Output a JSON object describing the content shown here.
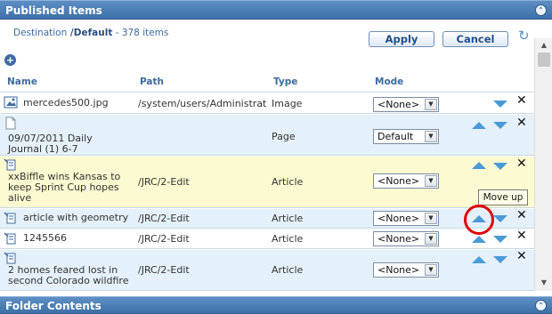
{
  "panel": {
    "title": "Published Items"
  },
  "breadcrumb": {
    "destination": "Destination",
    "sep": " /",
    "folder": "Default",
    "count_text": " - 378 items"
  },
  "toolbar": {
    "apply_label": "Apply",
    "cancel_label": "Cancel"
  },
  "columns": {
    "name": "Name",
    "path": "Path",
    "type": "Type",
    "mode": "Mode"
  },
  "rows": [
    {
      "name": "mercedes500.jpg",
      "path": "/system/users/Administrat",
      "type": "Image",
      "mode": "<None>",
      "icon": "image-icon"
    },
    {
      "name": "09/07/2011 Daily Journal (1) 6-7",
      "path": "",
      "type": "Page",
      "mode": "Default",
      "icon": "page-icon"
    },
    {
      "name": "xxBiffle wins Kansas to keep Sprint Cup hopes alive",
      "path": "/JRC/2-Edit",
      "type": "Article",
      "mode": "<None>",
      "icon": "article-icon"
    },
    {
      "name": "article with geometry",
      "path": "/JRC/2-Edit",
      "type": "Article",
      "mode": "<None>",
      "icon": "article-icon"
    },
    {
      "name": "1245566",
      "path": "/JRC/2-Edit",
      "type": "Article",
      "mode": "<None>",
      "icon": "article-icon"
    },
    {
      "name": "2 homes feared lost in second Colorado wildfire",
      "path": "/JRC/2-Edit",
      "type": "Article",
      "mode": "<None>",
      "icon": "article-icon"
    }
  ],
  "tooltip": {
    "text": "Move up"
  },
  "footer": {
    "title": "Folder Contents"
  },
  "colors": {
    "header": "#3d70a8",
    "arrow": "#4a9ad8",
    "highlight": "#e00000",
    "yellow_row": "#fbfad0",
    "blue_row": "#e4f0fa"
  }
}
